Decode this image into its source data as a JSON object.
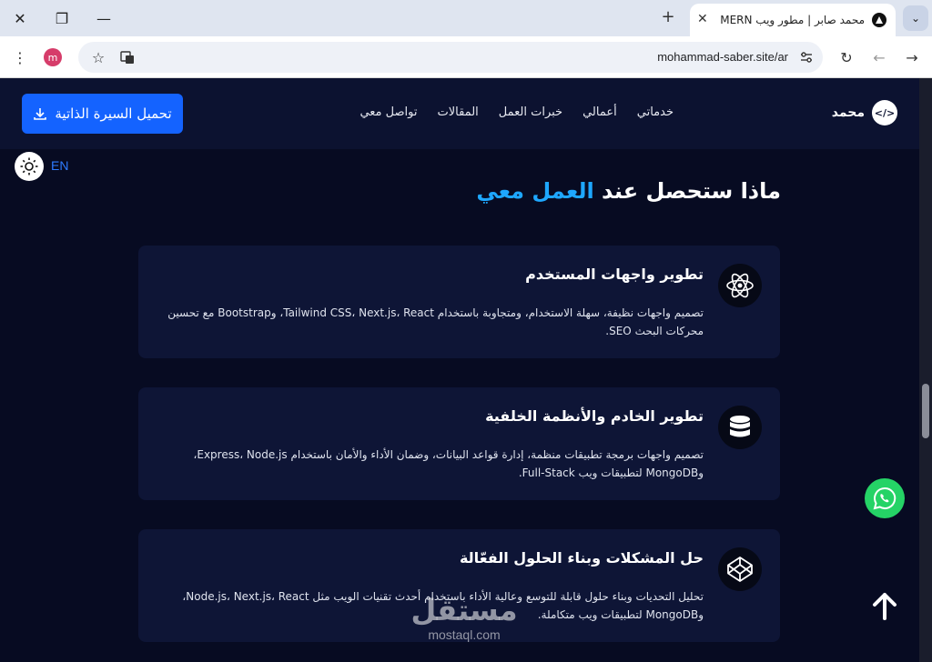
{
  "browser": {
    "tab_title": "محمد صابر | مطور ويب MERN و",
    "url": "mohammad-saber.site/ar",
    "profile_initial": "m"
  },
  "nav": {
    "brand_name": "محمد",
    "brand_logo_text": "</>",
    "links": [
      "خدماتي",
      "أعمالي",
      "خبرات العمل",
      "المقالات",
      "تواصل معي"
    ],
    "cv_button": "تحميل السيرة الذاتية"
  },
  "lang_toggle": "EN",
  "section": {
    "heading_main": "ماذا ستحصل عند",
    "heading_accent": "العمل معي"
  },
  "cards": [
    {
      "icon": "react-icon",
      "title": "تطوير واجهات المستخدم",
      "description": "تصميم واجهات نظيفة، سهلة الاستخدام، ومتجاوبة باستخدام Tailwind CSS، Next.js، React، وBootstrap مع تحسين محركات البحث SEO."
    },
    {
      "icon": "database-icon",
      "title": "تطوير الخادم والأنظمة الخلفية",
      "description": "تصميم واجهات برمجة تطبيقات منظمة، إدارة قواعد البيانات، وضمان الأداء والأمان باستخدام Express، Node.js، وMongoDB لتطبيقات ويب Full-Stack."
    },
    {
      "icon": "codepen-icon",
      "title": "حل المشكلات وبناء الحلول الفعّالة",
      "description": "تحليل التحديات وبناء حلول قابلة للتوسع وعالية الأداء باستخدام أحدث تقنيات الويب مثل Node.js، Next.js، React، وMongoDB لتطبيقات ويب متكاملة."
    }
  ],
  "watermark": {
    "arabic": "مستقل",
    "latin": "mostaql.com"
  },
  "colors": {
    "page_bg": "#070b22",
    "nav_bg": "#0c1230",
    "card_bg": "#0e1536",
    "accent": "#1ea7ff",
    "button": "#1463ff",
    "whatsapp": "#25d366"
  }
}
